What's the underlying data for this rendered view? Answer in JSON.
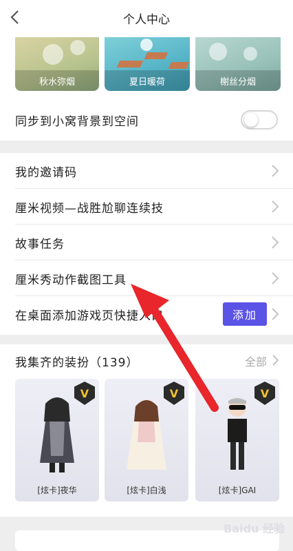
{
  "header": {
    "title": "个人中心"
  },
  "themes": [
    {
      "label": "秋水弥烟"
    },
    {
      "label": "夏日暖荷"
    },
    {
      "label": "榭丝分烟"
    }
  ],
  "sync": {
    "label": "同步到小窝背景到空间",
    "enabled": false
  },
  "menu": {
    "items": [
      {
        "label": "我的邀请码"
      },
      {
        "label": "厘米视频—战胜尬聊连续技"
      },
      {
        "label": "故事任务"
      },
      {
        "label": "厘米秀动作截图工具"
      },
      {
        "label": "在桌面添加游戏页快捷入口"
      }
    ],
    "add_label": "添加"
  },
  "collection": {
    "title": "我集齐的装扮（139）",
    "all_label": "全部",
    "badge": "V",
    "cards": [
      {
        "name": "[炫卡]夜华"
      },
      {
        "name": "[炫卡]白浅"
      },
      {
        "name": "[炫卡]GAI"
      }
    ]
  },
  "watermark": "Baidu 经验",
  "colors": {
    "accent": "#5b52e6",
    "arrow": "#e8262b",
    "badge_gold": "#f2c12e"
  }
}
